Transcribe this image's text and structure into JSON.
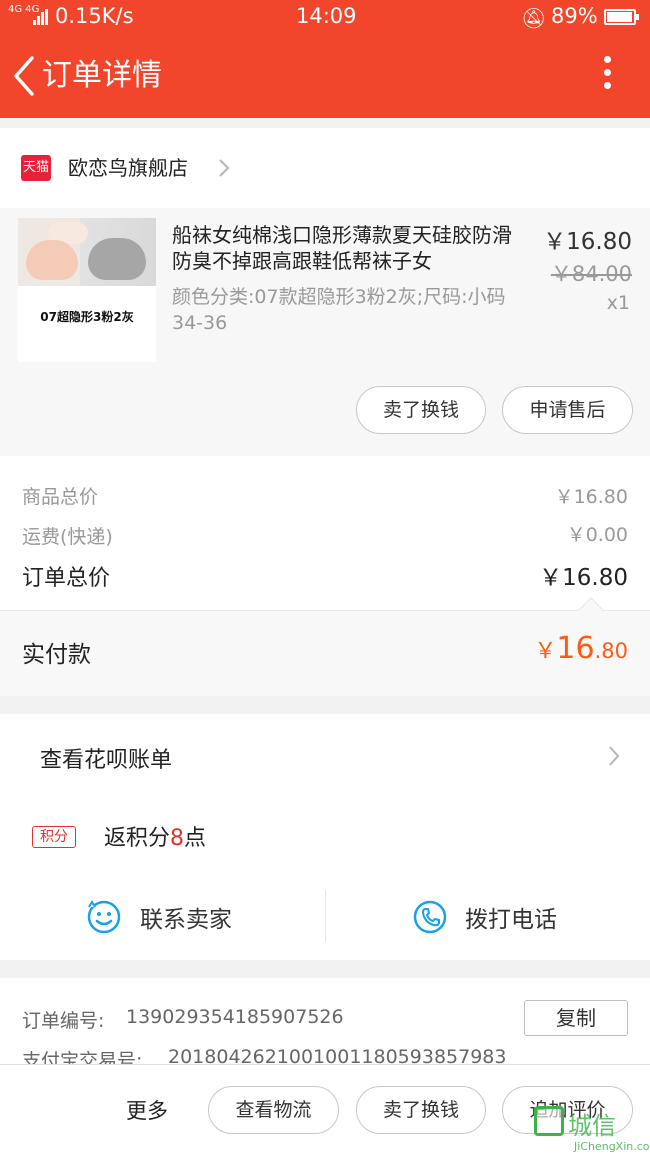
{
  "status_bar": {
    "network": "4G 4G",
    "speed": "0.15K/s",
    "time": "14:09",
    "battery": "89%",
    "battery_level": 0.89
  },
  "nav": {
    "title": "订单详情"
  },
  "shop": {
    "logo_text": "天猫",
    "name": "欧恋鸟旗舰店"
  },
  "product": {
    "image_caption": "07超隐形3粉2灰",
    "title": "船袜女纯棉浅口隐形薄款夏天硅胶防滑防臭不掉跟高跟鞋低帮袜子女",
    "spec": "颜色分类:07款超隐形3粉2灰;尺码:小码34-36",
    "price": "￥16.80",
    "original_price": "￥84.00",
    "quantity": "x1",
    "btn_sell": "卖了换钱",
    "btn_after_sale": "申请售后"
  },
  "summary": {
    "goods_total_label": "商品总价",
    "goods_total_value": "￥16.80",
    "shipping_label": "运费(快递)",
    "shipping_value": "￥0.00",
    "order_total_label": "订单总价",
    "order_total_value": "￥16.80",
    "paid_label": "实付款",
    "paid_currency": "￥",
    "paid_integer": "16",
    "paid_decimal": ".80"
  },
  "actions": {
    "huabei": "查看花呗账单",
    "points_badge": "积分",
    "points_prefix": "返积分",
    "points_value": "8",
    "points_suffix": "点",
    "contact_seller": "联系卖家",
    "call_phone": "拨打电话"
  },
  "order_info": {
    "order_no_label": "订单编号:",
    "order_no": "139029354185907526",
    "copy": "复制",
    "alipay_label": "支付宝交易号:",
    "alipay_no": "2018042621001001180593857983"
  },
  "bottom_bar": {
    "more": "更多",
    "logistics": "查看物流",
    "sell": "卖了换钱",
    "review": "追加评价"
  },
  "watermark": {
    "text": "城信",
    "url": "JiChengXin.com"
  },
  "colors": {
    "brand": "#f2462c",
    "price_accent": "#ff5a14",
    "points_red": "#e5302a"
  }
}
